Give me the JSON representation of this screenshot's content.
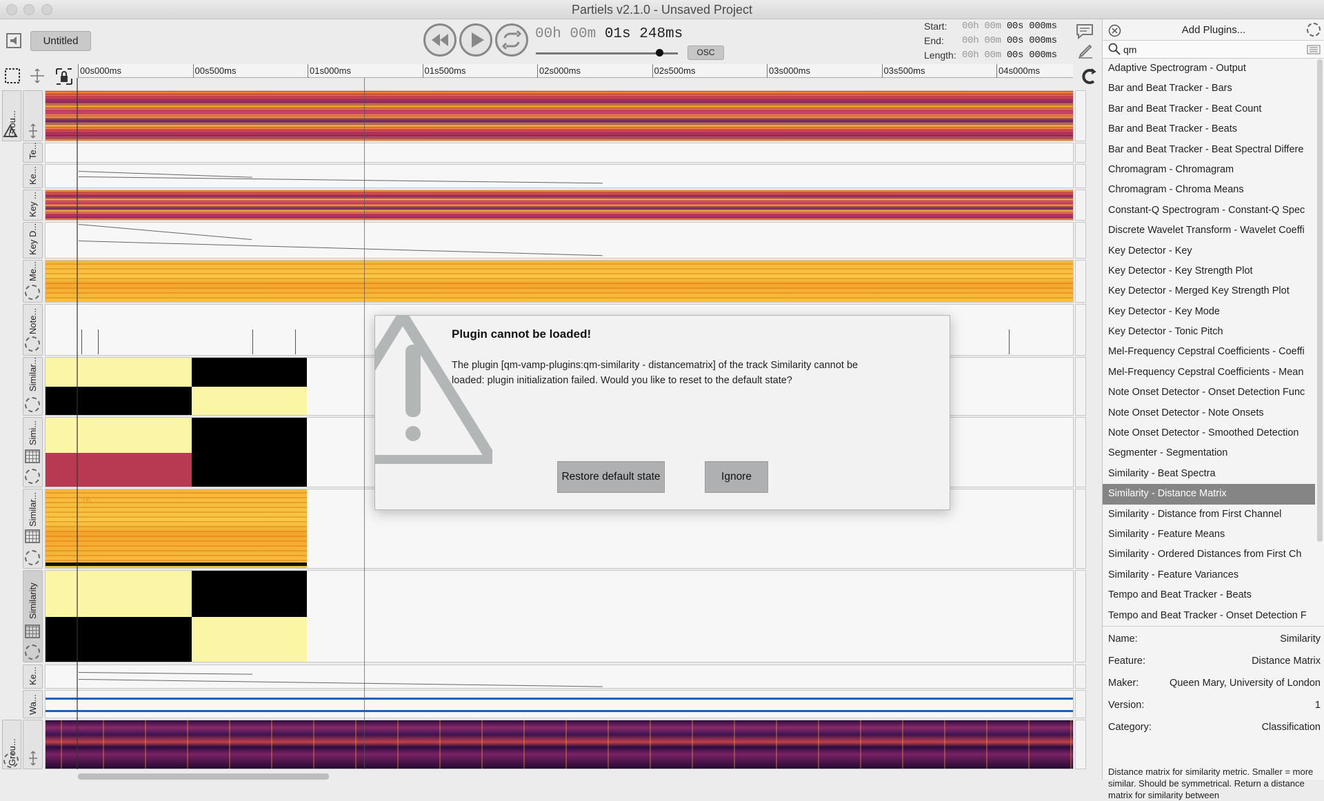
{
  "window": {
    "title": "Partiels v2.1.0 - Unsaved Project"
  },
  "toolbar": {
    "document_name": "Untitled",
    "time": {
      "dim": "00h 00m ",
      "bright": "01s 248ms"
    },
    "osc_label": "OSC",
    "range": {
      "start_label": "Start:",
      "end_label": "End:",
      "length_label": "Length:",
      "start_dim": "00h 00m ",
      "start_bright": "00s 000ms",
      "end_dim": "00h 00m ",
      "end_bright": "00s 000ms",
      "length_dim": "00h 00m ",
      "length_bright": "00s 000ms"
    }
  },
  "ruler": {
    "ticks": [
      "00s000ms",
      "00s500ms",
      "01s000ms",
      "01s500ms",
      "02s000ms",
      "02s500ms",
      "03s000ms",
      "03s500ms",
      "04s000ms"
    ]
  },
  "tracks": {
    "labels": [
      "Grou...",
      "Te...",
      "Ke...",
      "Key ...",
      "Key D...",
      "Me...",
      "Note...",
      "Similar...",
      "Simi...",
      "Similar...",
      "Similarity",
      "Ke...",
      "Wa...",
      "Grou..."
    ],
    "annotation_16": "16"
  },
  "dialog": {
    "title": "Plugin cannot be loaded!",
    "message": "The plugin [qm-vamp-plugins:qm-similarity - distancematrix] of the track Similarity cannot be loaded: plugin initialization failed. Would you like to reset to the default state?",
    "restore_label": "Restore default state",
    "ignore_label": "Ignore"
  },
  "plugins_panel": {
    "title": "Add Plugins...",
    "search_value": "qm",
    "items": [
      "Adaptive Spectrogram - Output",
      "Bar and Beat Tracker - Bars",
      "Bar and Beat Tracker - Beat Count",
      "Bar and Beat Tracker - Beats",
      "Bar and Beat Tracker - Beat Spectral Differe",
      "Chromagram - Chromagram",
      "Chromagram - Chroma Means",
      "Constant-Q Spectrogram - Constant-Q Spec",
      "Discrete Wavelet Transform - Wavelet Coeffi",
      "Key Detector - Key",
      "Key Detector - Key Strength Plot",
      "Key Detector - Merged Key Strength Plot",
      "Key Detector - Key Mode",
      "Key Detector - Tonic Pitch",
      "Mel-Frequency Cepstral Coefficients - Coeffi",
      "Mel-Frequency Cepstral Coefficients - Mean",
      "Note Onset Detector - Onset Detection Func",
      "Note Onset Detector - Note Onsets",
      "Note Onset Detector - Smoothed Detection",
      "Segmenter - Segmentation",
      "Similarity - Beat Spectra",
      "Similarity - Distance Matrix",
      "Similarity - Distance from First Channel",
      "Similarity - Feature Means",
      "Similarity - Ordered Distances from First Ch",
      "Similarity - Feature Variances",
      "Tempo and Beat Tracker - Beats",
      "Tempo and Beat Tracker - Onset Detection F"
    ],
    "selected_index": 21,
    "details": {
      "name_label": "Name:",
      "name_value": "Similarity",
      "feature_label": "Feature:",
      "feature_value": "Distance Matrix",
      "maker_label": "Maker:",
      "maker_value": "Queen Mary, University of London",
      "version_label": "Version:",
      "version_value": "1",
      "category_label": "Category:",
      "category_value": "Classification",
      "description": "Distance matrix for similarity metric.  Smaller = more similar.  Should be symmetrical. Return a distance matrix for similarity between"
    }
  },
  "colors": {
    "selected_row": "#858585",
    "sim_cream": "#fbf5a6",
    "sim_red": "#b83a52",
    "dialog_button": "#aeb0b1"
  }
}
